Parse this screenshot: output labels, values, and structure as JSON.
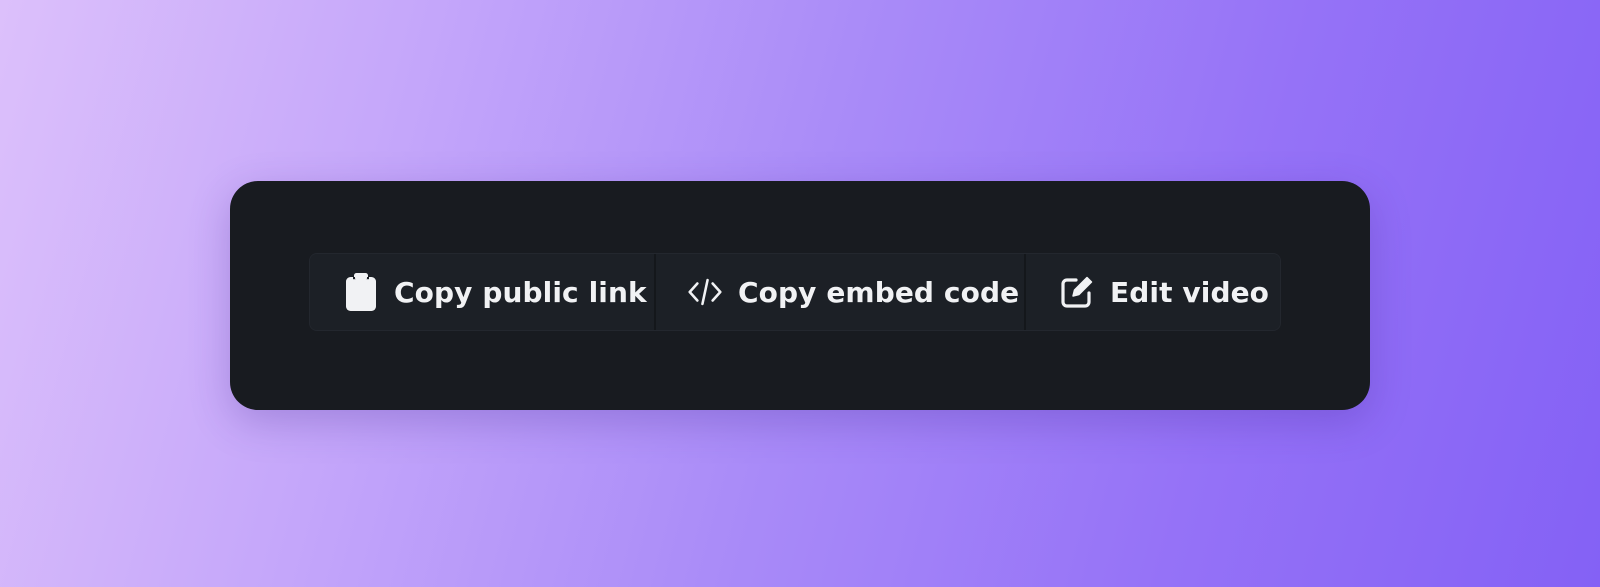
{
  "toolbar": {
    "copy_public_link": {
      "label": "Copy public link",
      "icon": "clipboard-icon"
    },
    "copy_embed_code": {
      "label": "Copy embed code",
      "icon": "code-icon"
    },
    "edit_video": {
      "label": "Edit video",
      "icon": "edit-icon"
    }
  },
  "colors": {
    "background_gradient_start": "#dcc0fb",
    "background_gradient_end": "#8461f5",
    "card_background": "#181b20",
    "toolbar_background": "#1c2026",
    "text": "#f1f2f4"
  }
}
